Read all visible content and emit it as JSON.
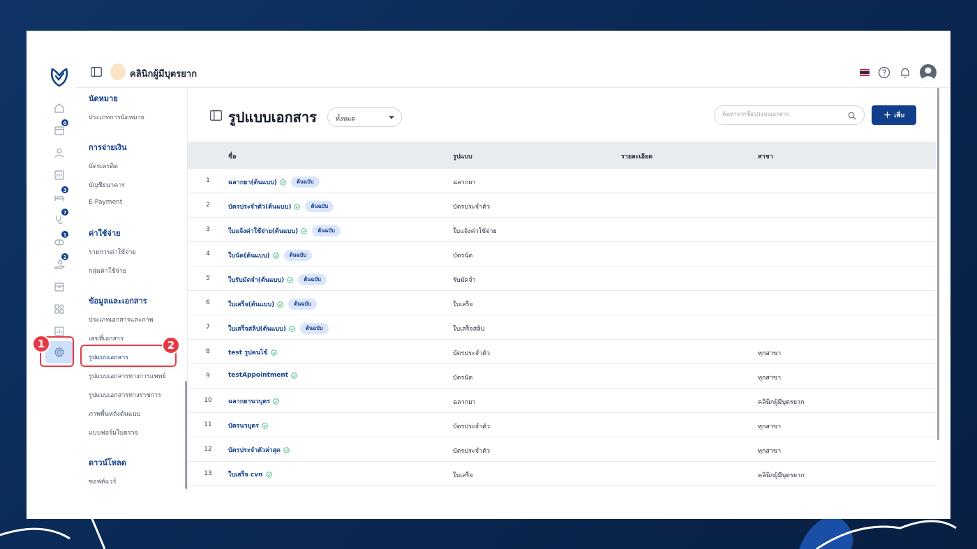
{
  "topbar": {
    "clinic_name": "คลินิกผู้มีบุตรยาก"
  },
  "rail": {
    "badges": {
      "appointments": "0",
      "queue": "3",
      "treatment": "7",
      "pharmacy": "1",
      "billing": "2"
    }
  },
  "callouts": {
    "one": "1",
    "two": "2"
  },
  "submenu": {
    "groups": [
      {
        "title": "นัดหมาย",
        "items": [
          "ประเภทการนัดหมาย"
        ]
      },
      {
        "title": "การจ่ายเงิน",
        "items": [
          "บัตรเครดิต",
          "บัญชีธนาคาร",
          "E-Payment"
        ]
      },
      {
        "title": "ค่าใช้จ่าย",
        "items": [
          "รายการค่าใช้จ่าย",
          "กลุ่มค่าใช้จ่าย"
        ]
      },
      {
        "title": "ข้อมูลและเอกสาร",
        "items": [
          "ประเภทเอกสารและภาพ",
          "เลขที่เอกสาร",
          "รูปแบบเอกสาร",
          "รูปแบบเอกสารทางการแพทย์",
          "รูปแบบเอกสารทางราชการ",
          "ภาพพื้นหลังต้นแบบ",
          "แบบฟอร์มใบตรวจ"
        ]
      },
      {
        "title": "ดาวน์โหลด",
        "items": [
          "ซอฟต์แวร์"
        ]
      }
    ]
  },
  "page": {
    "title": "รูปแบบเอกสาร",
    "filter_value": "ทั้งหมด",
    "search_placeholder": "ค้นหาจากชื่อรูปแบบเอกสาร",
    "add_label": "เพิ่ม"
  },
  "table": {
    "headers": {
      "name": "ชื่อ",
      "format": "รูปแบบ",
      "detail": "รายละเอียด",
      "branch": "สาขา"
    },
    "rows": [
      {
        "num": "1",
        "name": "ฉลากยา(ต้นแบบ)",
        "tag": "ต้นฉบับ",
        "format": "ฉลากยา",
        "branch": ""
      },
      {
        "num": "2",
        "name": "บัตรประจำตัว(ต้นแบบ)",
        "tag": "ต้นฉบับ",
        "format": "บัตรประจำตัว",
        "branch": ""
      },
      {
        "num": "3",
        "name": "ใบแจ้งค่าใช้จ่าย(ต้นแบบ)",
        "tag": "ต้นฉบับ",
        "format": "ใบแจ้งค่าใช้จ่าย",
        "branch": ""
      },
      {
        "num": "4",
        "name": "ใบนัด(ต้นแบบ)",
        "tag": "ต้นฉบับ",
        "format": "บัตรนัด",
        "branch": ""
      },
      {
        "num": "5",
        "name": "ใบรับมัดจำ(ต้นแบบ)",
        "tag": "ต้นฉบับ",
        "format": "รับมัดจำ",
        "branch": ""
      },
      {
        "num": "6",
        "name": "ใบเสร็จ(ต้นแบบ)",
        "tag": "ต้นฉบับ",
        "format": "ใบเสร็จ",
        "branch": ""
      },
      {
        "num": "7",
        "name": "ใบเสร็จสลิป(ต้นแบบ)",
        "tag": "ต้นฉบับ",
        "format": "ใบเสร็จสลิป",
        "branch": ""
      },
      {
        "num": "8",
        "name": "test รูปคนไข้",
        "tag": "",
        "format": "บัตรประจำตัว",
        "branch": "ทุกสาขา"
      },
      {
        "num": "9",
        "name": "testAppointment",
        "tag": "",
        "format": "บัตรนัด",
        "branch": "ทุกสาขา"
      },
      {
        "num": "10",
        "name": "ฉลากยานวบุตร",
        "tag": "",
        "format": "ฉลากยา",
        "branch": "คลินิกผู้มีบุตรยาก"
      },
      {
        "num": "11",
        "name": "บัตรนวบุตร",
        "tag": "",
        "format": "บัตรประจำตัว",
        "branch": "ทุกสาขา"
      },
      {
        "num": "12",
        "name": "บัตรประจำตัวล่าสุด",
        "tag": "",
        "format": "บัตรประจำตัว",
        "branch": "ทุกสาขา"
      },
      {
        "num": "13",
        "name": "ใบเสร็จ cvn",
        "tag": "",
        "format": "ใบเสร็จ",
        "branch": "คลินิกผู้มีบุตรยาก"
      }
    ]
  },
  "colors": {
    "primary": "#123f8c",
    "accent_bg": "#cfe0fb",
    "callout": "#e63946",
    "header_bg": "#e9ecef"
  }
}
